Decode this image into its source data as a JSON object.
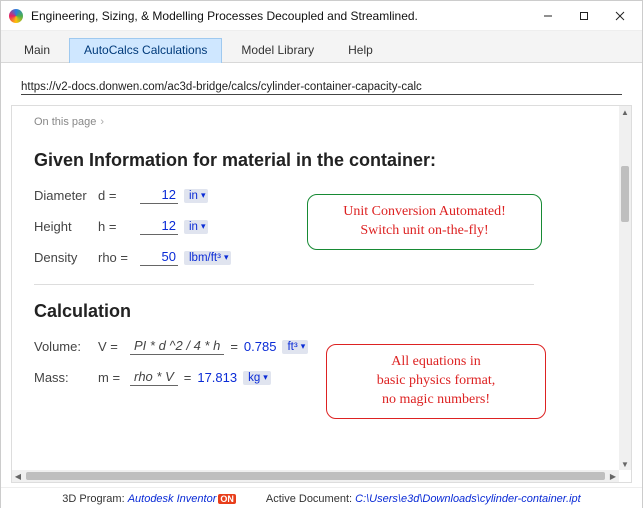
{
  "window": {
    "title": "Engineering, Sizing, & Modelling Processes Decoupled and Streamlined."
  },
  "tabs": [
    {
      "label": "Main"
    },
    {
      "label": "AutoCalcs Calculations"
    },
    {
      "label": "Model Library"
    },
    {
      "label": "Help"
    }
  ],
  "active_tab_index": 1,
  "url": "https://v2-docs.donwen.com/ac3d-bridge/calcs/cylinder-container-capacity-calc",
  "on_this_page_label": "On this page",
  "sections": {
    "given": {
      "heading": "Given Information for material in the container:",
      "fields": {
        "diameter": {
          "label": "Diameter",
          "symbol": "d =",
          "value": "12",
          "unit": "in"
        },
        "height": {
          "label": "Height",
          "symbol": "h =",
          "value": "12",
          "unit": "in"
        },
        "density": {
          "label": "Density",
          "symbol": "rho =",
          "value": "50",
          "unit": "lbm/ft³"
        }
      }
    },
    "calc": {
      "heading": "Calculation",
      "volume": {
        "label": "Volume:",
        "symbol": "V =",
        "formula": "PI * d ^2 / 4 * h",
        "eq": "=",
        "result": "0.785",
        "unit": "ft³"
      },
      "mass": {
        "label": "Mass:",
        "symbol": "m =",
        "formula": "rho * V",
        "eq": "=",
        "result": "17.813",
        "unit": "kg"
      }
    }
  },
  "callouts": {
    "green": {
      "line1": "Unit Conversion Automated!",
      "line2": "Switch unit on-the-fly!"
    },
    "red": {
      "line1": "All equations in",
      "line2": "basic physics format,",
      "line3": "no magic numbers!"
    }
  },
  "status": {
    "prog_label": "3D Program:",
    "prog_value": "Autodesk Inventor",
    "prog_badge": "ON",
    "doc_label": "Active Document:",
    "doc_value": "C:\\Users\\e3d\\Downloads\\cylinder-container.ipt"
  }
}
